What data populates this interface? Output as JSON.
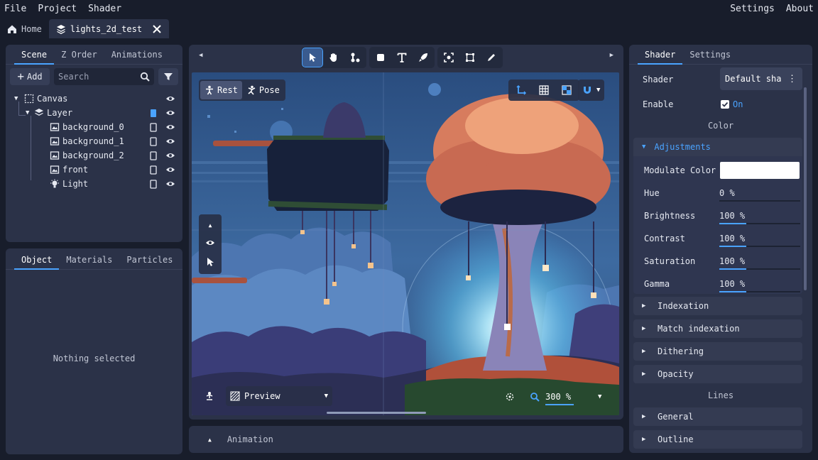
{
  "menu": {
    "file": "File",
    "project": "Project",
    "shader": "Shader",
    "settings": "Settings",
    "about": "About"
  },
  "tabs": {
    "home": "Home",
    "file": "lights_2d_test"
  },
  "scene_panel": {
    "tabs": [
      "Scene",
      "Z Order",
      "Animations"
    ],
    "add_label": "Add",
    "search_placeholder": "Search",
    "tree": [
      {
        "label": "Canvas"
      },
      {
        "label": "Layer"
      },
      {
        "label": "background_0"
      },
      {
        "label": "background_1"
      },
      {
        "label": "background_2"
      },
      {
        "label": "front"
      },
      {
        "label": "Light"
      }
    ]
  },
  "object_panel": {
    "tabs": [
      "Object",
      "Materials",
      "Particles"
    ],
    "empty": "Nothing selected"
  },
  "viewport": {
    "rest_label": "Rest",
    "pose_label": "Pose",
    "preview_label": "Preview",
    "zoom": "300 %"
  },
  "animation_panel": {
    "label": "Animation"
  },
  "shader_panel": {
    "tabs": [
      "Shader",
      "Settings"
    ],
    "shader_label": "Shader",
    "shader_value": "Default sha",
    "enable_label": "Enable",
    "enable_value": "On",
    "color_heading": "Color",
    "adjustments_label": "Adjustments",
    "modulate_label": "Modulate Color",
    "modulate_color": "#ffffff",
    "props": [
      {
        "label": "Hue",
        "value": "0 %",
        "fill": 0
      },
      {
        "label": "Brightness",
        "value": "100 %",
        "fill": 0.33
      },
      {
        "label": "Contrast",
        "value": "100 %",
        "fill": 0.33
      },
      {
        "label": "Saturation",
        "value": "100 %",
        "fill": 0.33
      },
      {
        "label": "Gamma",
        "value": "100 %",
        "fill": 0.33
      }
    ],
    "sections_color": [
      "Indexation",
      "Match indexation",
      "Dithering",
      "Opacity"
    ],
    "lines_heading": "Lines",
    "sections_lines": [
      "General",
      "Outline"
    ]
  },
  "colors": {
    "accent": "#4aa3ff",
    "panel": "#2b3248",
    "bg": "#181d2b"
  }
}
